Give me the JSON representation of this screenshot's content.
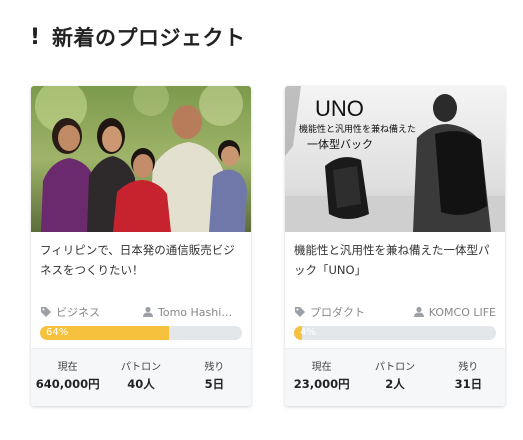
{
  "section": {
    "title": "新着のプロジェクト"
  },
  "projects": [
    {
      "title": "フィリピンで、日本発の通信販売ビジネスをつくりたい！",
      "category": "ビジネス",
      "owner": "Tomo Hashimoto",
      "progress_percent": 64,
      "progress_label": "64%",
      "stats": [
        {
          "label": "現在",
          "value": "640,000円"
        },
        {
          "label": "パトロン",
          "value": "40人"
        },
        {
          "label": "残り",
          "value": "5日"
        }
      ]
    },
    {
      "title": "機能性と汎用性を兼ね備えた一体型パック「UNO」",
      "category": "プロダクト",
      "owner": "KOMCO LIFE",
      "progress_percent": 4,
      "progress_label": "4%",
      "image_text": {
        "brand": "UNO",
        "line1": "機能性と汎用性を兼ね備えた",
        "line2": "一体型バック"
      },
      "stats": [
        {
          "label": "現在",
          "value": "23,000円"
        },
        {
          "label": "パトロン",
          "value": "2人"
        },
        {
          "label": "残り",
          "value": "31日"
        }
      ]
    }
  ],
  "colors": {
    "progress_fill": "#f6c13c",
    "progress_track": "#e4e7ea",
    "stats_bg": "#f5f7f9"
  }
}
